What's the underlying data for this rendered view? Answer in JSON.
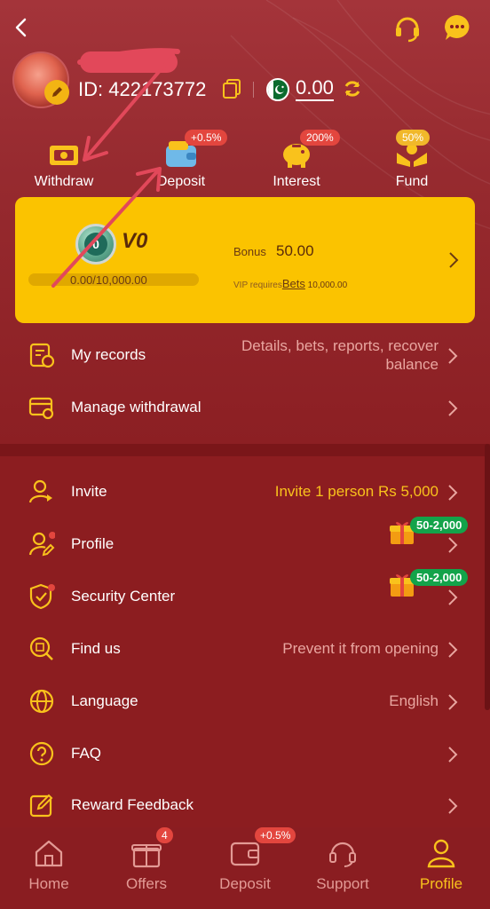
{
  "profile": {
    "id_label": "ID:",
    "id_value": "422173772",
    "balance": "0.00"
  },
  "quick_actions": [
    {
      "label": "Withdraw",
      "badge": ""
    },
    {
      "label": "Deposit",
      "badge": "+0.5%"
    },
    {
      "label": "Interest",
      "badge": "200%"
    },
    {
      "label": "Fund",
      "badge": "50%"
    }
  ],
  "vip": {
    "badge_number": "0",
    "level": "V0",
    "progress": "0.00/10,000.00",
    "progress_fraction": 0,
    "bonus_label": "Bonus",
    "bonus_value": "50.00",
    "req_prefix": "VIP requires",
    "req_link": "Bets",
    "req_value": "10,000.00"
  },
  "menu_top": [
    {
      "label": "My records",
      "value_line1": "Details, bets, reports, recover",
      "value_line2": "balance"
    },
    {
      "label": "Manage withdrawal",
      "value": ""
    }
  ],
  "menu_main": [
    {
      "label": "Invite",
      "value": "Invite 1 person Rs 5,000"
    },
    {
      "label": "Profile",
      "value": "",
      "badge": "50-2,000"
    },
    {
      "label": "Security Center",
      "value": "",
      "badge": "50-2,000"
    },
    {
      "label": "Find us",
      "value": "Prevent it from opening"
    },
    {
      "label": "Language",
      "value": "English"
    },
    {
      "label": "FAQ",
      "value": ""
    },
    {
      "label": "Reward Feedback",
      "value": ""
    }
  ],
  "bottom_nav": [
    {
      "label": "Home",
      "badge": ""
    },
    {
      "label": "Offers",
      "badge": "4"
    },
    {
      "label": "Deposit",
      "badge": "+0.5%"
    },
    {
      "label": "Support",
      "badge": ""
    },
    {
      "label": "Profile",
      "badge": "",
      "active": true
    }
  ],
  "colors": {
    "background": "#8c1d20",
    "accent": "#f9c21c",
    "card": "#fbc300",
    "badge_red": "#e3463e",
    "badge_green": "#13a34a"
  }
}
